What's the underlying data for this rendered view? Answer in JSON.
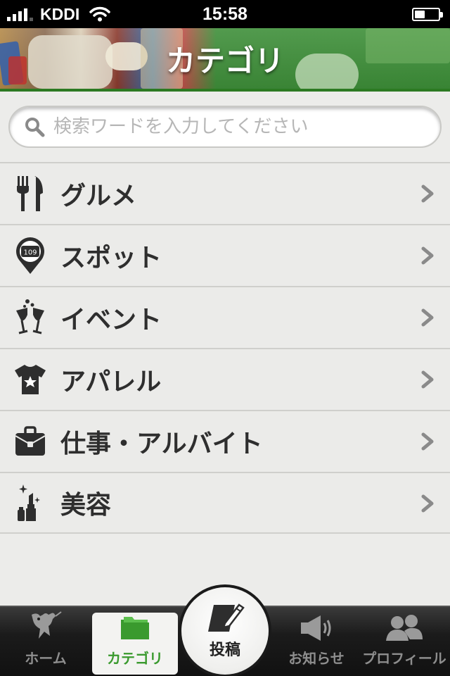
{
  "status_bar": {
    "carrier": "KDDI",
    "time": "15:58",
    "battery_level": 0.45,
    "signal_bars": 4
  },
  "header": {
    "title": "カテゴリ"
  },
  "search": {
    "placeholder": "検索ワードを入力してください",
    "value": ""
  },
  "categories": [
    {
      "label": "グルメ",
      "icon": "fork-knife-icon"
    },
    {
      "label": "スポット",
      "icon": "map-pin-109-icon"
    },
    {
      "label": "イベント",
      "icon": "champagne-glasses-icon"
    },
    {
      "label": "アパレル",
      "icon": "tshirt-icon"
    },
    {
      "label": "仕事・アルバイト",
      "icon": "briefcase-icon"
    },
    {
      "label": "美容",
      "icon": "lipstick-sparkle-icon"
    }
  ],
  "pin_text": "109",
  "tabbar": {
    "home": "ホーム",
    "category": "カテゴリ",
    "post": "投稿",
    "news": "お知らせ",
    "profile": "プロフィール",
    "active": "category"
  },
  "colors": {
    "accent_green": "#3a9a2e",
    "header_border": "#2c7a22",
    "list_bg": "#ebebe9",
    "text_dark": "#2e2e2e"
  }
}
